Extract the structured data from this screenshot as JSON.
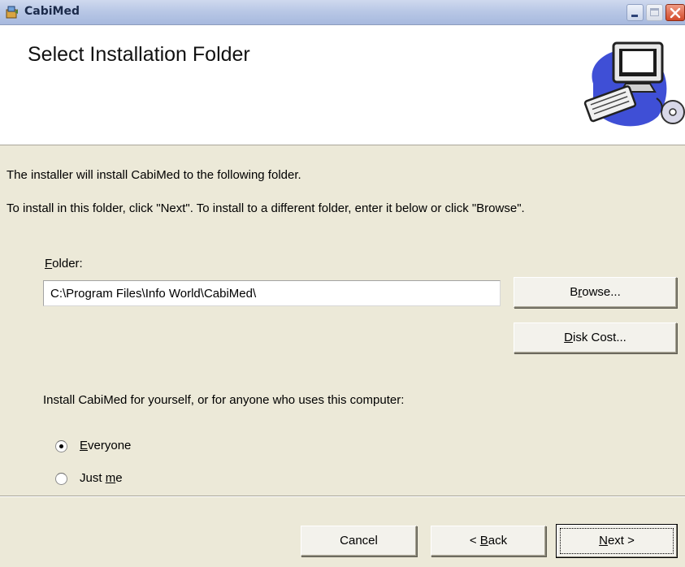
{
  "window": {
    "title": "CabiMed",
    "icon": "installer-icon"
  },
  "banner": {
    "title": "Select Installation Folder",
    "art": "computer-cd-illustration"
  },
  "body": {
    "line1": "The installer will install CabiMed to the following folder.",
    "line2": "To install in this folder, click \"Next\". To install to a different folder, enter it below or click \"Browse\"."
  },
  "folder": {
    "label_accel": "F",
    "label_rest": "older:",
    "value": "C:\\Program Files\\Info World\\CabiMed\\"
  },
  "buttons": {
    "browse_pre": "B",
    "browse_accel": "r",
    "browse_post": "owse...",
    "diskcost_accel": "D",
    "diskcost_post": "isk Cost...",
    "cancel": "Cancel",
    "back_pre": "< ",
    "back_accel": "B",
    "back_post": "ack",
    "next_accel": "N",
    "next_post": "ext >"
  },
  "install_for": {
    "prompt": "Install CabiMed for yourself, or for anyone who uses this computer:",
    "options": [
      {
        "accel": "E",
        "rest": "veryone",
        "selected": true
      },
      {
        "pre": "Just ",
        "accel": "m",
        "rest": "e",
        "selected": false
      }
    ]
  }
}
